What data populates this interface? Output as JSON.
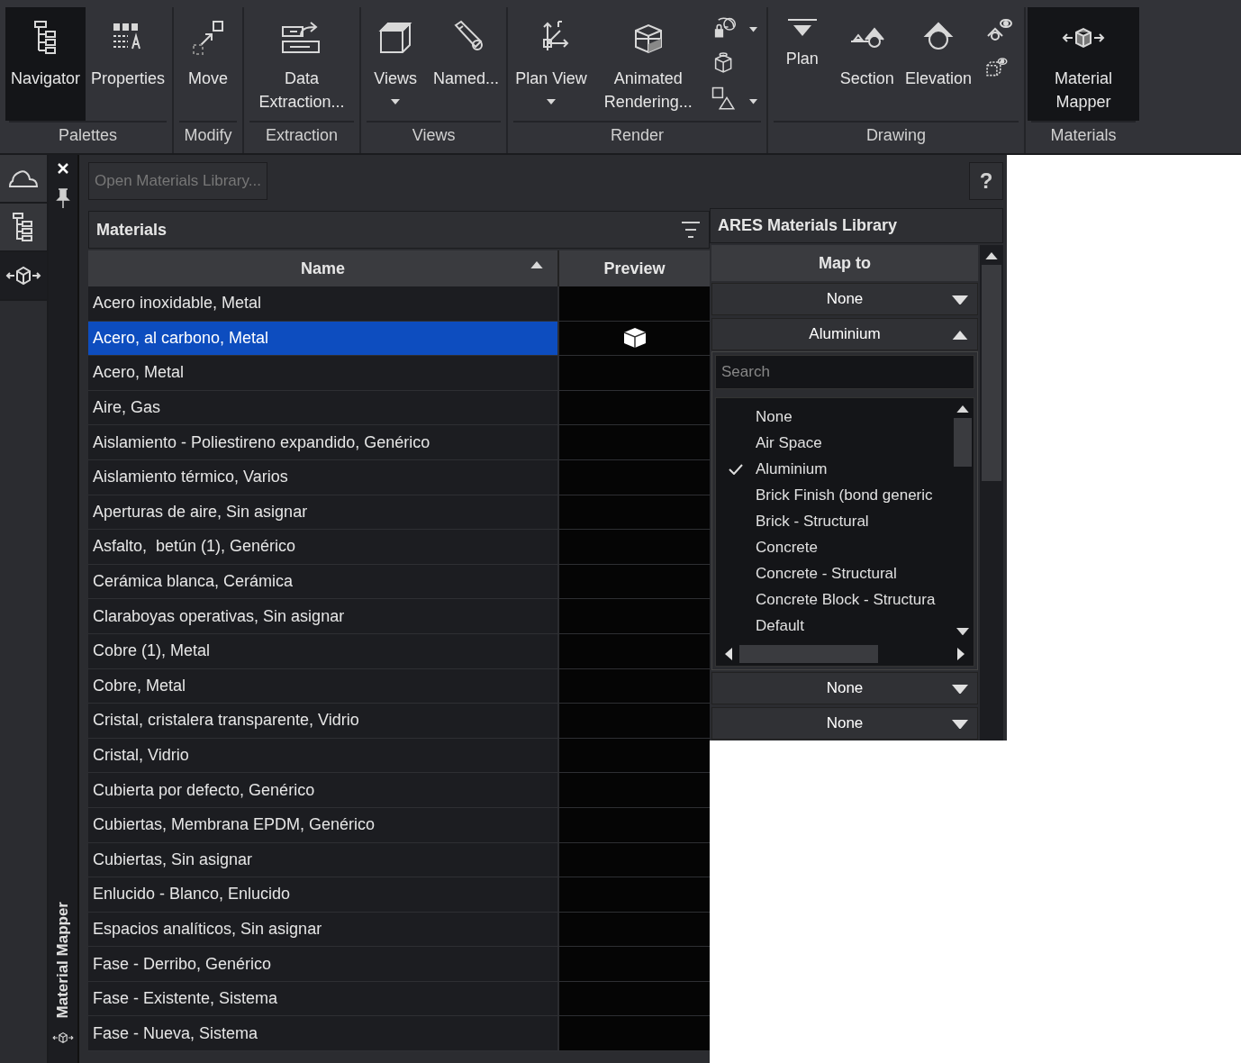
{
  "ribbon": {
    "groups": [
      {
        "label": "Palettes",
        "buttons": [
          {
            "kind": "large",
            "label": "Navigator",
            "selected": true,
            "dropdown": false
          },
          {
            "kind": "large",
            "label": "Properties",
            "selected": false,
            "dropdown": false
          }
        ]
      },
      {
        "label": "Modify",
        "buttons": [
          {
            "kind": "large",
            "label": "Move",
            "selected": false,
            "dropdown": false
          }
        ]
      },
      {
        "label": "Extraction",
        "buttons": [
          {
            "kind": "large",
            "label": "Data Extraction...",
            "selected": false,
            "dropdown": false
          }
        ]
      },
      {
        "label": "Views",
        "buttons": [
          {
            "kind": "large",
            "label": "Views",
            "selected": false,
            "dropdown": true
          },
          {
            "kind": "large",
            "label": "Named...",
            "selected": false,
            "dropdown": false
          }
        ]
      },
      {
        "label": "Render",
        "buttons": [
          {
            "kind": "large",
            "label": "Plan View",
            "selected": false,
            "dropdown": true
          },
          {
            "kind": "large",
            "label": "Animated Rendering...",
            "selected": false,
            "dropdown": false
          },
          {
            "kind": "stack"
          }
        ]
      },
      {
        "label": "Drawing",
        "buttons": [
          {
            "kind": "large",
            "label": "Plan",
            "selected": false,
            "dropdown": false
          },
          {
            "kind": "large",
            "label": "Section",
            "selected": false,
            "dropdown": false
          },
          {
            "kind": "large",
            "label": "Elevation",
            "selected": false,
            "dropdown": false
          },
          {
            "kind": "stack"
          }
        ]
      },
      {
        "label": "Materials",
        "buttons": [
          {
            "kind": "large",
            "label": "Material Mapper",
            "selected": true,
            "dropdown": false
          }
        ]
      }
    ]
  },
  "side_tabs": [
    {
      "selected": false
    },
    {
      "selected": false
    },
    {
      "selected": true
    }
  ],
  "palette_title": "Material Mapper",
  "toolbar": {
    "open_library": "Open Materials Library...",
    "help": "?"
  },
  "materials": {
    "title": "Materials",
    "columns": [
      "Name",
      "Preview"
    ],
    "rows": [
      {
        "name": "Acero inoxidable, Metal",
        "selected": false,
        "preview": false
      },
      {
        "name": "Acero, al carbono, Metal",
        "selected": true,
        "preview": true
      },
      {
        "name": "Acero, Metal",
        "selected": false,
        "preview": false
      },
      {
        "name": "Aire, Gas",
        "selected": false,
        "preview": false
      },
      {
        "name": "Aislamiento - Poliestireno expandido, Genérico",
        "selected": false,
        "preview": false
      },
      {
        "name": "Aislamiento térmico, Varios",
        "selected": false,
        "preview": false
      },
      {
        "name": "Aperturas de aire, Sin asignar",
        "selected": false,
        "preview": false
      },
      {
        "name": "Asfalto,  betún (1), Genérico",
        "selected": false,
        "preview": false
      },
      {
        "name": "Cerámica blanca, Cerámica",
        "selected": false,
        "preview": false
      },
      {
        "name": "Claraboyas operativas, Sin asignar",
        "selected": false,
        "preview": false
      },
      {
        "name": "Cobre (1), Metal",
        "selected": false,
        "preview": false
      },
      {
        "name": "Cobre, Metal",
        "selected": false,
        "preview": false
      },
      {
        "name": "Cristal, cristalera transparente, Vidrio",
        "selected": false,
        "preview": false
      },
      {
        "name": "Cristal, Vidrio",
        "selected": false,
        "preview": false
      },
      {
        "name": "Cubierta por defecto, Genérico",
        "selected": false,
        "preview": false
      },
      {
        "name": "Cubiertas, Membrana EPDM, Genérico",
        "selected": false,
        "preview": false
      },
      {
        "name": "Cubiertas, Sin asignar",
        "selected": false,
        "preview": false
      },
      {
        "name": "Enlucido - Blanco, Enlucido",
        "selected": false,
        "preview": false
      },
      {
        "name": "Espacios analíticos, Sin asignar",
        "selected": false,
        "preview": false
      },
      {
        "name": "Fase - Derribo, Genérico",
        "selected": false,
        "preview": false
      },
      {
        "name": "Fase - Existente, Sistema",
        "selected": false,
        "preview": false
      },
      {
        "name": "Fase - Nueva, Sistema",
        "selected": false,
        "preview": false
      }
    ]
  },
  "library": {
    "title": "ARES Materials Library",
    "column": "Map to",
    "map_top": [
      {
        "value": "None",
        "expanded": false
      },
      {
        "value": "Aluminium",
        "expanded": true
      }
    ],
    "dropdown": {
      "placeholder": "Search",
      "options": [
        {
          "label": "None",
          "selected": false
        },
        {
          "label": "Air Space",
          "selected": false
        },
        {
          "label": "Aluminium",
          "selected": true
        },
        {
          "label": "Brick Finish (bond generic",
          "selected": false
        },
        {
          "label": "Brick - Structural",
          "selected": false
        },
        {
          "label": "Concrete",
          "selected": false
        },
        {
          "label": "Concrete - Structural",
          "selected": false
        },
        {
          "label": "Concrete Block - Structura",
          "selected": false
        },
        {
          "label": "Default",
          "selected": false
        }
      ]
    },
    "map_bottom": [
      {
        "value": "None",
        "expanded": false
      },
      {
        "value": "None",
        "expanded": false
      }
    ]
  }
}
